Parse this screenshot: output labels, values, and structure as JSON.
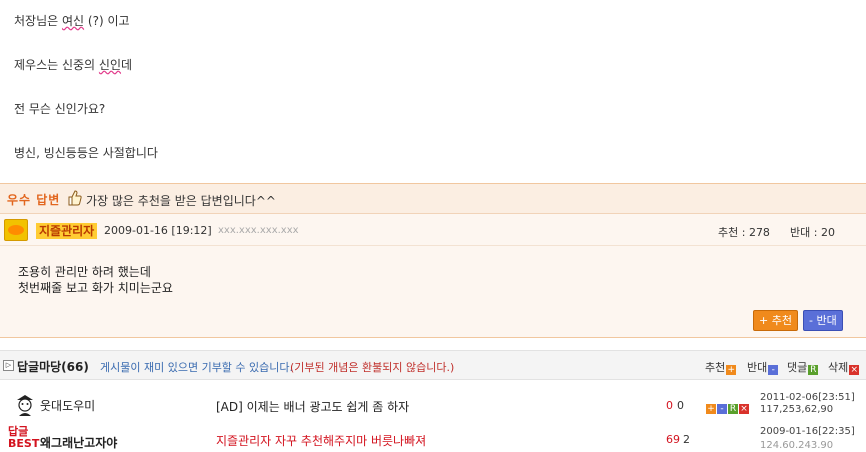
{
  "post": {
    "lines": [
      {
        "parts": [
          "처장님은 ",
          "여신",
          " (?) 이고"
        ]
      },
      {
        "parts": [
          "제우스는 신중의 ",
          "신인",
          "데"
        ]
      },
      {
        "parts": [
          "전 무슨 신인가요?"
        ]
      },
      {
        "parts": [
          "병신, 빙신등등은 사절합니다"
        ]
      }
    ]
  },
  "best": {
    "label": "우수 답변",
    "description": "가장 많은 추천을 받은 답변입니다^^",
    "nickname": "지즐관리자",
    "date": "2009-01-16 [19:12]",
    "ip": "xxx.xxx.xxx.xxx",
    "votes": "추천 : 278",
    "against": "반대 : 20",
    "text_lines": [
      "조용히 관리만 하려 했는데",
      "첫번째줄 보고 화가 치미는군요"
    ],
    "recommend_button": "+ 추천",
    "oppose_button": "- 반대"
  },
  "comments": {
    "title": "답글마당(66)",
    "description": "게시물이 재미 있으면 기부할 수 있습니다.",
    "note": "(기부된 개념은 환불되지 않습니다.)",
    "sort": {
      "recommend": "추천",
      "oppose": "반대",
      "reply": "댓글",
      "delete": "삭제"
    },
    "rows": [
      {
        "nickname": "웃대도우미",
        "title": "[AD] 이제는 배너 광고도 쉽게 좀 하자",
        "count_a": "0",
        "count_b": "0",
        "date": "2011-02-06[23:51]",
        "ip": "117,253,62,90"
      },
      {
        "tag": "답글",
        "tag2": "BEST",
        "nickname": "왜그래난고자야",
        "title": "지즐관리자 자꾸 추천해주지마 버릇나빠져",
        "count_a": "69",
        "count_b": "2",
        "date": "2009-01-16[22:35]",
        "ip": "124.60.243.90"
      }
    ]
  },
  "colors": {
    "accent": "#e2661e",
    "link": "#3a6bb0",
    "alert": "#c0302c"
  }
}
